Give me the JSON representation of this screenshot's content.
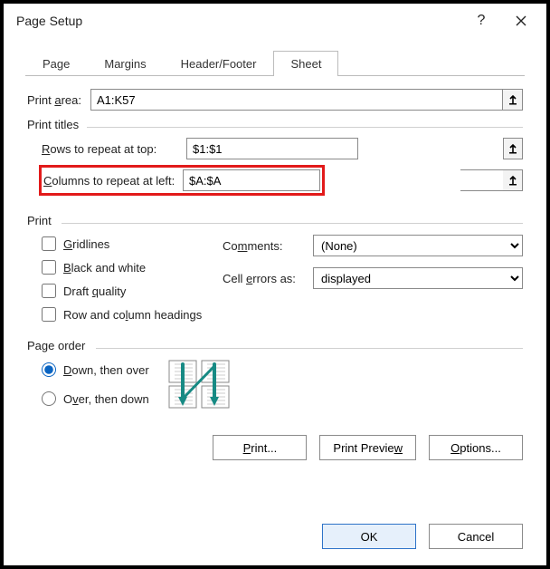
{
  "title": "Page Setup",
  "tabs": [
    "Page",
    "Margins",
    "Header/Footer",
    "Sheet"
  ],
  "active_tab": 3,
  "print_area": {
    "label_prefix": "Print ",
    "label_u": "a",
    "label_suffix": "rea:",
    "value": "A1:K57"
  },
  "print_titles": {
    "legend": "Print titles",
    "rows": {
      "u": "R",
      "rest": "ows to repeat at top:",
      "value": "$1:$1"
    },
    "cols": {
      "u": "C",
      "rest": "olumns to repeat at left:",
      "value": "$A:$A"
    }
  },
  "print": {
    "legend": "Print",
    "gridlines": {
      "u": "G",
      "rest": "ridlines",
      "checked": false
    },
    "bw": {
      "pre": "",
      "u": "B",
      "rest": "lack and white",
      "checked": false
    },
    "draft": {
      "pre": "Draft ",
      "u": "q",
      "rest": "uality",
      "checked": false
    },
    "rowcol": {
      "pre": "Row and co",
      "u": "l",
      "rest": "umn headings",
      "checked": false
    },
    "comments": {
      "pre": "Co",
      "u": "m",
      "rest": "ments:",
      "value": "(None)"
    },
    "errors": {
      "pre": "Cell ",
      "u": "e",
      "rest": "rrors as:",
      "value": "displayed"
    }
  },
  "page_order": {
    "legend": "Page order",
    "down_over": {
      "u": "D",
      "rest": "own, then over",
      "checked": true
    },
    "over_down": {
      "pre": "O",
      "u": "v",
      "rest": "er, then down",
      "checked": false
    }
  },
  "buttons": {
    "print": {
      "u": "P",
      "rest": "rint..."
    },
    "preview": {
      "pre": "Print Previe",
      "u": "w",
      "rest": ""
    },
    "options": {
      "u": "O",
      "rest": "ptions..."
    },
    "ok": "OK",
    "cancel": "Cancel"
  }
}
